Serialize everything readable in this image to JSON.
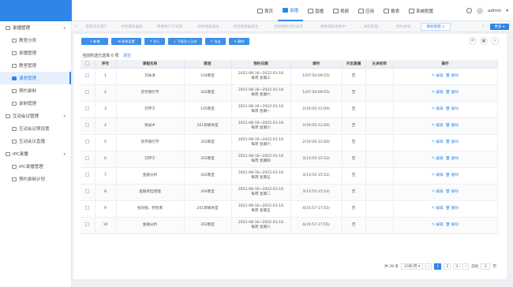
{
  "colors": {
    "accent": "#2f86e8",
    "button": "#3d8fe8"
  },
  "topnav": [
    {
      "label": "首页",
      "icon": "home-icon",
      "active": false
    },
    {
      "label": "录播",
      "icon": "record-icon",
      "active": true
    },
    {
      "label": "直播",
      "icon": "live-icon",
      "active": false
    },
    {
      "label": "视频",
      "icon": "video-icon",
      "active": false
    },
    {
      "label": "应用",
      "icon": "app-icon",
      "active": false
    },
    {
      "label": "报表",
      "icon": "report-icon",
      "active": false
    },
    {
      "label": "系统配置",
      "icon": "settings-icon",
      "active": false
    }
  ],
  "user": {
    "name": "admin"
  },
  "sidebar": [
    {
      "type": "group",
      "label": "录播管理"
    },
    {
      "type": "item",
      "label": "教室分类",
      "active": false
    },
    {
      "type": "item",
      "label": "录播管理",
      "active": false
    },
    {
      "type": "item",
      "label": "教室管理",
      "active": false
    },
    {
      "type": "item",
      "label": "课表管理",
      "active": true
    },
    {
      "type": "item",
      "label": "预约录制",
      "active": false
    },
    {
      "type": "item",
      "label": "录制管理",
      "active": false
    },
    {
      "type": "group",
      "label": "互动会议管理"
    },
    {
      "type": "item",
      "label": "互动会议预设置",
      "active": false
    },
    {
      "type": "item",
      "label": "互动会议直播",
      "active": false
    },
    {
      "type": "group",
      "label": "IPC录播"
    },
    {
      "type": "item",
      "label": "IPC录播管理",
      "active": false
    },
    {
      "type": "item",
      "label": "预约录制计划",
      "active": false
    }
  ],
  "tabs": [
    {
      "label": "首播或多用户",
      "active": false
    },
    {
      "label": "视频播放器录",
      "active": false
    },
    {
      "label": "课播用户方式管",
      "active": false
    },
    {
      "label": "视频播放器录",
      "active": false
    },
    {
      "label": "视频播放器录生",
      "active": false
    },
    {
      "label": "视频播放同时录建",
      "active": false
    },
    {
      "label": "视频播放录制中",
      "active": false
    },
    {
      "label": "录制管理",
      "active": false
    },
    {
      "label": "预约录制",
      "active": false
    },
    {
      "label": "课表管理 ×",
      "active": true
    }
  ],
  "more_label": "更多 ▾",
  "toolbar": [
    {
      "label": "+ 新增"
    },
    {
      "label": "⊞ 周排设置"
    },
    {
      "label": "↑ 导入"
    },
    {
      "label": "↓ 下载导入日志"
    },
    {
      "label": "↑ 导出"
    },
    {
      "label": "✕ 删除"
    }
  ],
  "selection": {
    "text": "当前所选已选择 0 项",
    "clear": "清空"
  },
  "columns": [
    "",
    "序号",
    "课程名称",
    "教室",
    "预约日期",
    "课时",
    "开启直播",
    "主讲老师",
    "操作"
  ],
  "rows": [
    [
      "1",
      "刘永泽",
      "104教室",
      "2021-08-16~2022-01-16",
      "每周 星期三",
      "1(07:50-09:55)",
      "否",
      ""
    ],
    [
      "2",
      "货币银行学",
      "302教室",
      "2021-08-16~2022-01-16",
      "每周 星期六",
      "1(07:50-09:55)",
      "否",
      ""
    ],
    [
      "3",
      "刘宇宁",
      "105教室",
      "2021-08-16~2022-01-16",
      "每周 星期一",
      "2(10:05-12:00)",
      "否",
      ""
    ],
    [
      "4",
      "张加木",
      "201新媒体室",
      "2021-08-16~2022-01-16",
      "每周 星期六",
      "2(10:05-12:00)",
      "否",
      ""
    ],
    [
      "5",
      "货币银行学",
      "302教室",
      "2021-08-16~2022-01-16",
      "每周 星期六",
      "2(10:05-12:00)",
      "否",
      ""
    ],
    [
      "6",
      "刘宇宁",
      "302教室",
      "2021-08-16~2022-01-16",
      "每周 星期四",
      "3(13:55-15:52)",
      "否",
      ""
    ],
    [
      "7",
      "金融分析",
      "302教室",
      "2021-08-16~2022-01-16",
      "每周 星期五",
      "3(13:55-15:52)",
      "否",
      ""
    ],
    [
      "8",
      "金融风险管理",
      "304教室",
      "2021-08-16~2022-01-16",
      "每周 星期二",
      "3(13:55-15:52)",
      "否",
      ""
    ],
    [
      "9",
      "张剑锐、罗智勇",
      "201新媒体室",
      "2021-08-16~2022-01-16",
      "每周 星期五",
      "4(15:57-17:55)",
      "否",
      ""
    ],
    [
      "10",
      "金融分析",
      "302教室",
      "2021-08-16~2022-01-16",
      "每周 星期六",
      "4(15:57-17:55)",
      "否",
      ""
    ]
  ],
  "row_actions": {
    "edit": "✎ 编辑",
    "delete": "🗑 删除"
  },
  "pagination": {
    "total": "共 28 条",
    "page_size": "10条/页 ▾",
    "prev": "‹",
    "pages": [
      "1",
      "2",
      "3"
    ],
    "current": "1",
    "next": "›",
    "goto_label": "前往",
    "goto_value": "1",
    "page_suffix": "页"
  }
}
